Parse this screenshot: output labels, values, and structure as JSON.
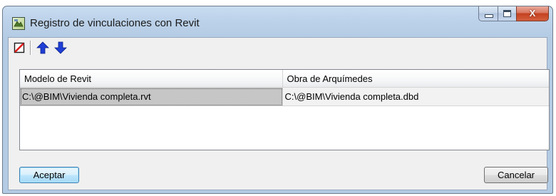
{
  "window": {
    "title": "Registro de vinculaciones con Revit",
    "close_glyph": "X"
  },
  "toolbar": {
    "items": [
      {
        "name": "delete-icon"
      },
      {
        "name": "arrow-up-icon"
      },
      {
        "name": "arrow-down-icon"
      }
    ]
  },
  "table": {
    "columns": [
      "Modelo de Revit",
      "Obra de Arquímedes"
    ],
    "rows": [
      [
        "C:\\@BIM\\Vivienda completa.rvt",
        "C:\\@BIM\\Vivienda completa.dbd"
      ]
    ]
  },
  "buttons": {
    "accept": "Aceptar",
    "cancel": "Cancelar"
  },
  "colors": {
    "title_bar": "#bcd2ea",
    "client_bg": "#f0f0f0",
    "selected_cell": "#c6c6c6",
    "arrow_blue": "#1f3fd6",
    "delete_red": "#e01b1b"
  }
}
